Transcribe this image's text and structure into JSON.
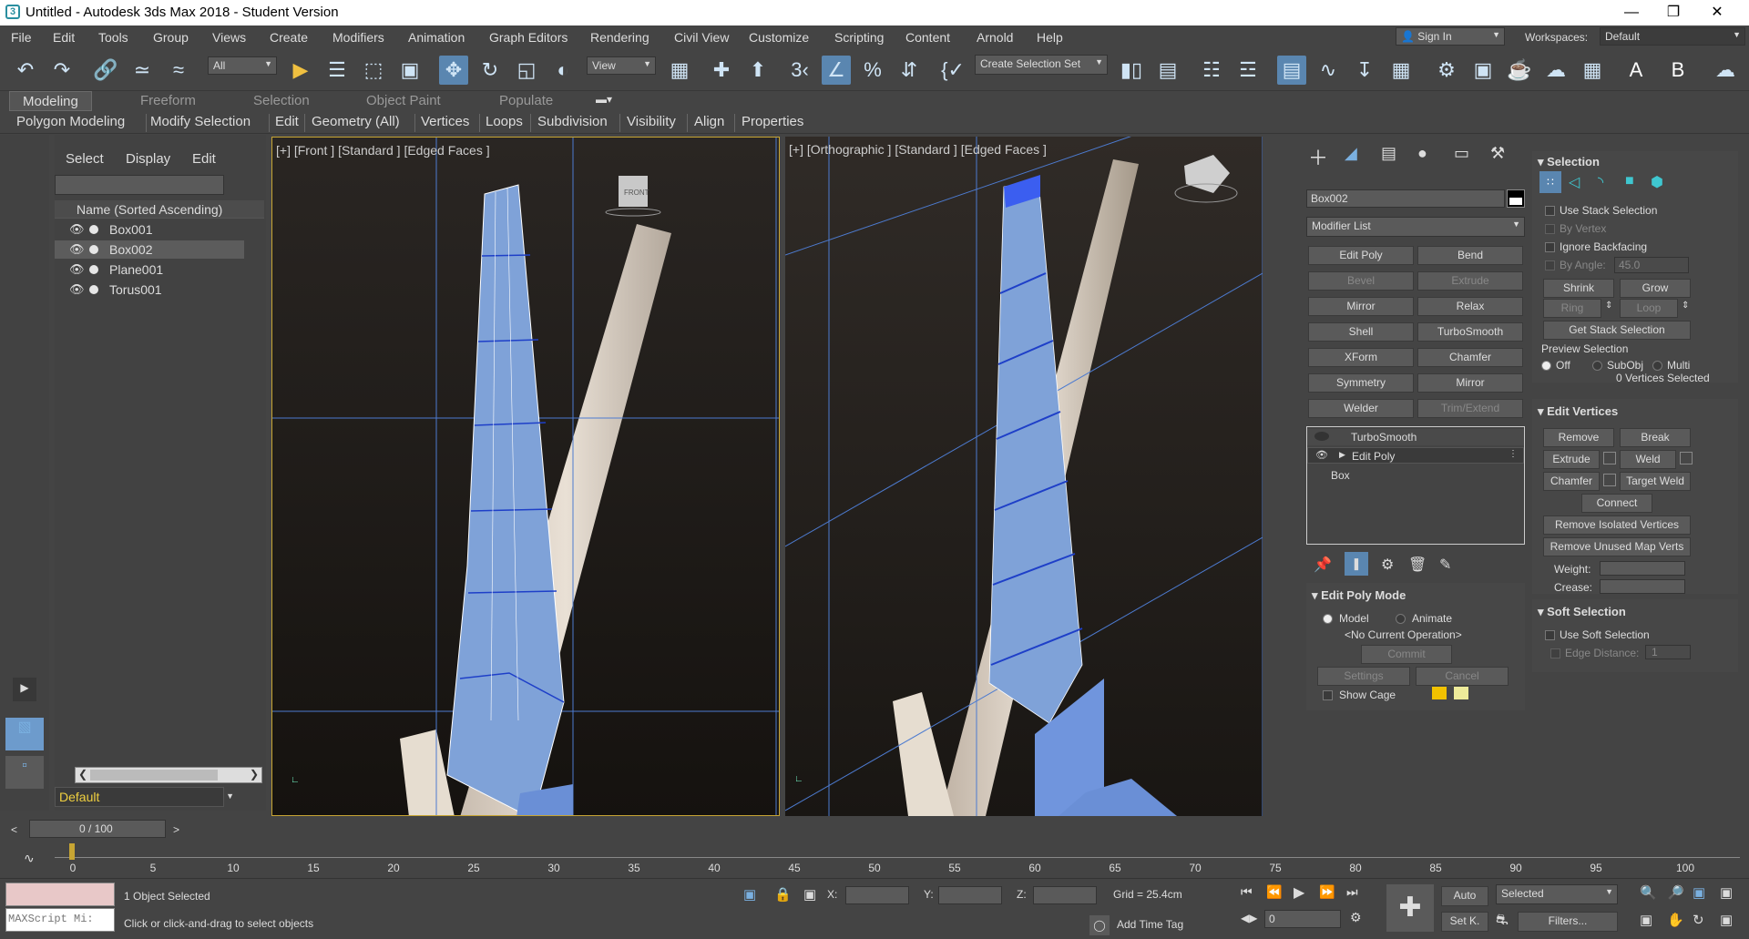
{
  "title": "Untitled - Autodesk 3ds Max 2018 - Student Version",
  "window_controls": [
    "minimize",
    "restore",
    "close"
  ],
  "menus": [
    "File",
    "Edit",
    "Tools",
    "Group",
    "Views",
    "Create",
    "Modifiers",
    "Animation",
    "Graph Editors",
    "Rendering",
    "Civil View",
    "Customize",
    "Scripting",
    "Content",
    "Arnold",
    "Help"
  ],
  "account": {
    "sign_in": "Sign In",
    "workspaces_label": "Workspaces:",
    "workspace": "Default"
  },
  "toolbar": {
    "filter": "All",
    "ref_coord": "View",
    "selection_set": "Create Selection Set"
  },
  "ribbon_tabs": [
    "Modeling",
    "Freeform",
    "Selection",
    "Object Paint",
    "Populate"
  ],
  "ribbon_items": [
    "Polygon Modeling",
    "Modify Selection",
    "Edit",
    "Geometry (All)",
    "Vertices",
    "Loops",
    "Subdivision",
    "Visibility",
    "Align",
    "Properties"
  ],
  "scene_explorer": {
    "menu": [
      "Select",
      "Display",
      "Edit"
    ],
    "column_header": "Name (Sorted Ascending)",
    "objects": [
      "Box001",
      "Box002",
      "Plane001",
      "Torus001"
    ],
    "selected": "Box002",
    "layer": "Default"
  },
  "viewports": {
    "left": "[+] [Front ] [Standard ] [Edged Faces ]",
    "right": "[+] [Orthographic ] [Standard ] [Edged Faces ]",
    "viewcube_left": "FRONT"
  },
  "command_panel": {
    "object_name": "Box002",
    "object_color": "#ffffff",
    "modifier_list": "Modifier List",
    "modifier_buttons": [
      [
        "Edit Poly",
        "Bend"
      ],
      [
        "Bevel",
        "Extrude"
      ],
      [
        "Mirror",
        "Relax"
      ],
      [
        "Shell",
        "TurboSmooth"
      ],
      [
        "XForm",
        "Chamfer"
      ],
      [
        "Symmetry",
        "Mirror"
      ],
      [
        "Welder",
        "Trim/Extend"
      ]
    ],
    "stack": [
      "TurboSmooth",
      "Edit Poly",
      "Box"
    ],
    "edit_poly_mode": {
      "title": "Edit Poly Mode",
      "model": "Model",
      "animate": "Animate",
      "operation": "<No Current Operation>",
      "commit": "Commit",
      "settings": "Settings",
      "cancel": "Cancel",
      "show_cage": "Show Cage",
      "cage_colors": [
        "#f2c200",
        "#eeeb9a"
      ]
    },
    "selection": {
      "title": "Selection",
      "use_stack": "Use Stack Selection",
      "by_vertex": "By Vertex",
      "ignore_backfacing": "Ignore Backfacing",
      "by_angle": "By Angle:",
      "angle": "45.0",
      "shrink": "Shrink",
      "grow": "Grow",
      "ring": "Ring",
      "loop": "Loop",
      "get_stack": "Get Stack Selection",
      "preview": "Preview Selection",
      "off": "Off",
      "subobj": "SubObj",
      "multi": "Multi",
      "status": "0 Vertices Selected"
    },
    "edit_vertices": {
      "title": "Edit Vertices",
      "remove": "Remove",
      "break": "Break",
      "extrude": "Extrude",
      "weld": "Weld",
      "chamfer": "Chamfer",
      "target_weld": "Target Weld",
      "connect": "Connect",
      "remove_isolated": "Remove Isolated Vertices",
      "remove_unused": "Remove Unused Map Verts",
      "weight": "Weight:",
      "crease": "Crease:"
    },
    "soft_selection": {
      "title": "Soft Selection",
      "use_soft": "Use Soft Selection",
      "edge_distance": "Edge Distance:",
      "edge_value": "1"
    }
  },
  "timeline": {
    "frame": "0 / 100",
    "ticks": [
      "0",
      "5",
      "10",
      "15",
      "20",
      "25",
      "30",
      "35",
      "40",
      "45",
      "50",
      "55",
      "60",
      "65",
      "70",
      "75",
      "80",
      "85",
      "90",
      "95",
      "100"
    ]
  },
  "status": {
    "maxscript": "MAXScript Mi:",
    "selected": "1 Object Selected",
    "prompt": "Click or click-and-drag to select objects",
    "x": "X:",
    "y": "Y:",
    "z": "Z:",
    "grid": "Grid = 25.4cm",
    "add_time_tag": "Add Time Tag",
    "auto": "Auto",
    "set_key": "Set K.",
    "key_mode": "Selected",
    "filters": "Filters...",
    "frame": "0"
  }
}
